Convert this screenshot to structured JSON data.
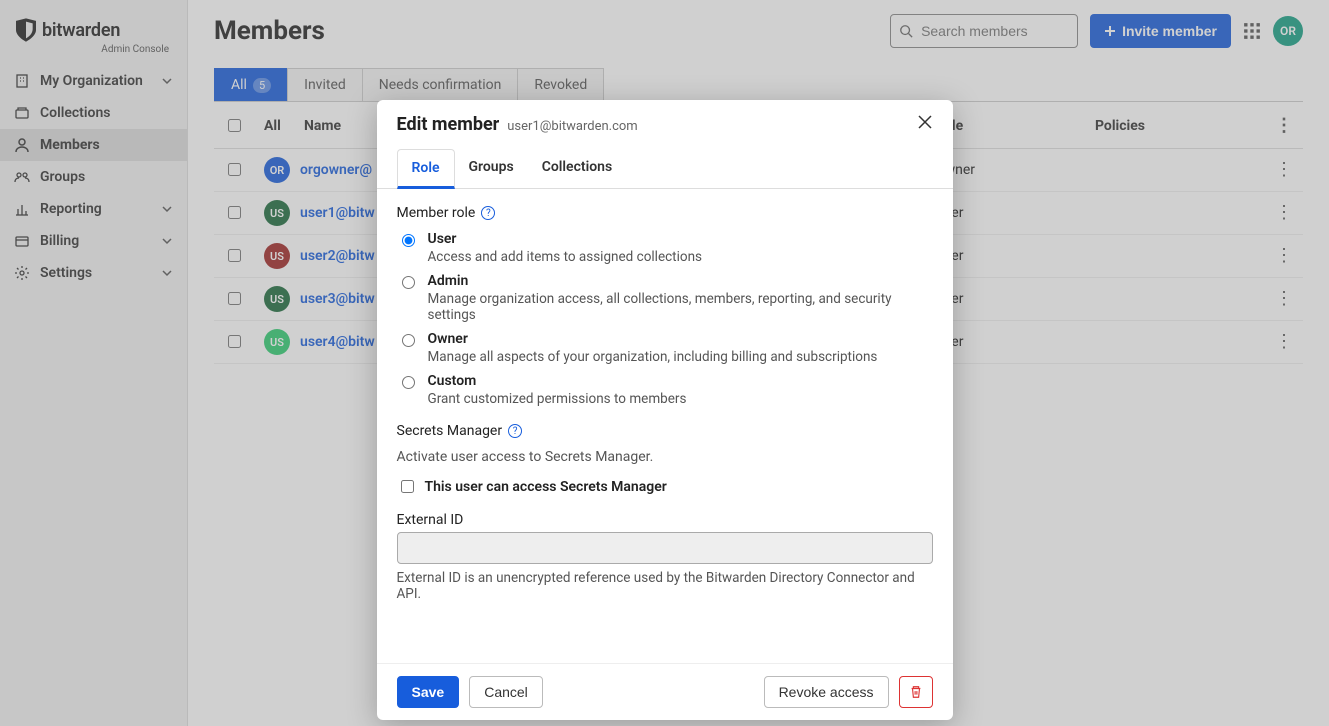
{
  "brand": {
    "name": "bitwarden",
    "subtitle": "Admin Console"
  },
  "sidebar": {
    "items": [
      {
        "label": "My Organization",
        "chev": true
      },
      {
        "label": "Collections"
      },
      {
        "label": "Members",
        "active": true
      },
      {
        "label": "Groups"
      },
      {
        "label": "Reporting",
        "chev": true
      },
      {
        "label": "Billing",
        "chev": true
      },
      {
        "label": "Settings",
        "chev": true
      }
    ]
  },
  "header": {
    "title": "Members",
    "search_placeholder": "Search members",
    "invite_label": "Invite member",
    "avatar_text": "OR",
    "avatar_color": "#16A085"
  },
  "tabs": [
    {
      "label": "All",
      "badge": "5",
      "active": true
    },
    {
      "label": "Invited"
    },
    {
      "label": "Needs confirmation"
    },
    {
      "label": "Revoked"
    }
  ],
  "table": {
    "cols": {
      "all": "All",
      "name": "Name",
      "role": "Role",
      "policies": "Policies"
    },
    "rows": [
      {
        "avatar": "OR",
        "color": "#175DDC",
        "name": "orgowner@",
        "role": "Owner"
      },
      {
        "avatar": "US",
        "color": "#1C6B3C",
        "name": "user1@bitw",
        "role": "User"
      },
      {
        "avatar": "US",
        "color": "#A02725",
        "name": "user2@bitw",
        "role": "User"
      },
      {
        "avatar": "US",
        "color": "#1C6B3C",
        "name": "user3@bitw",
        "role": "User"
      },
      {
        "avatar": "US",
        "color": "#2ECC71",
        "name": "user4@bitw",
        "role": "User"
      }
    ]
  },
  "modal": {
    "title": "Edit member",
    "subtitle": "user1@bitwarden.com",
    "tabs": [
      {
        "label": "Role",
        "active": true
      },
      {
        "label": "Groups"
      },
      {
        "label": "Collections"
      }
    ],
    "role_section_label": "Member role",
    "roles": [
      {
        "name": "User",
        "desc": "Access and add items to assigned collections",
        "checked": true
      },
      {
        "name": "Admin",
        "desc": "Manage organization access, all collections, members, reporting, and security settings"
      },
      {
        "name": "Owner",
        "desc": "Manage all aspects of your organization, including billing and subscriptions"
      },
      {
        "name": "Custom",
        "desc": "Grant customized permissions to members"
      }
    ],
    "secrets_label": "Secrets Manager",
    "secrets_desc": "Activate user access to Secrets Manager.",
    "secrets_check_label": "This user can access Secrets Manager",
    "external_label": "External ID",
    "external_hint": "External ID is an unencrypted reference used by the Bitwarden Directory Connector and API.",
    "footer": {
      "save": "Save",
      "cancel": "Cancel",
      "revoke": "Revoke access"
    }
  }
}
